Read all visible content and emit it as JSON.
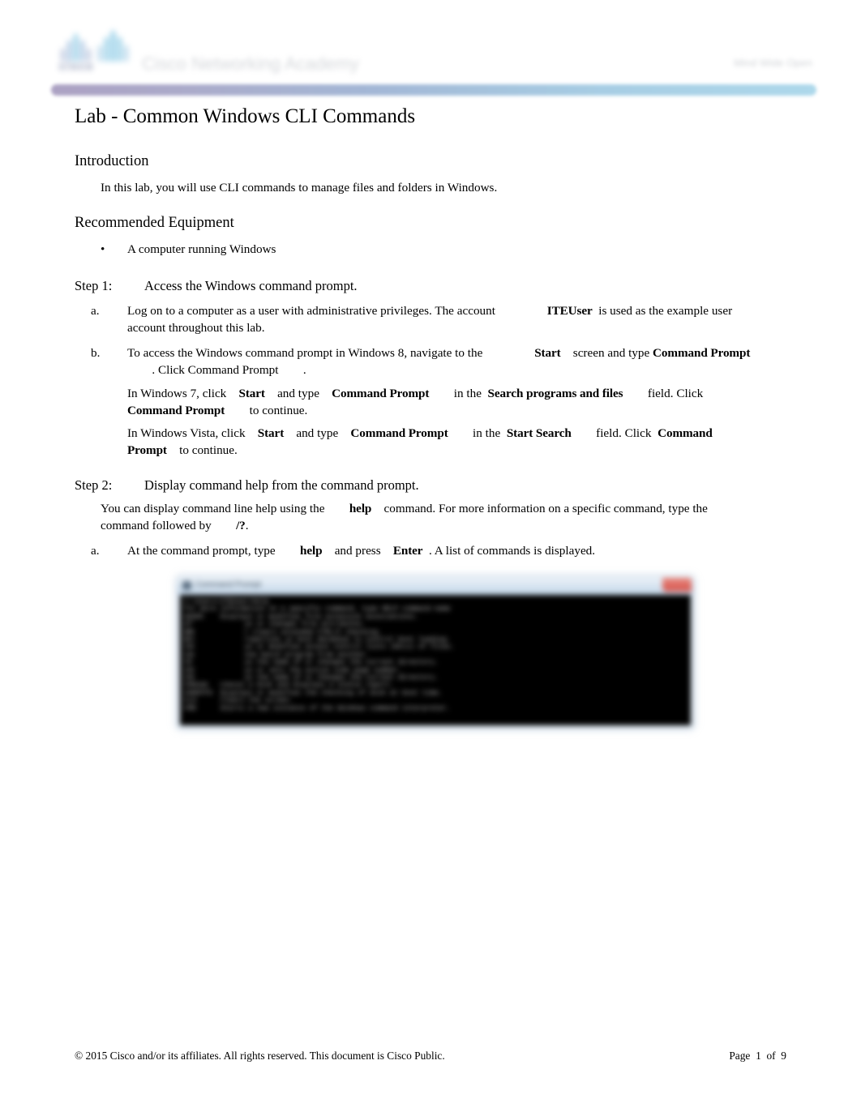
{
  "header": {
    "logo_word": "cisco",
    "brand": "Cisco Networking Academy",
    "tagline": "Mind Wide Open",
    "accent_left": "#a89dc0",
    "accent_right": "#a9d6ea"
  },
  "document": {
    "title": "Lab - Common Windows CLI Commands"
  },
  "sections": {
    "introduction": {
      "heading": "Introduction",
      "paragraph": "In this lab, you will use CLI commands to manage files and folders in Windows."
    },
    "equipment": {
      "heading": "Recommended Equipment",
      "bullet_glyph": "•",
      "items": [
        "A computer running Windows"
      ]
    }
  },
  "steps": [
    {
      "label": "Step 1:",
      "title": "Access the Windows command prompt.",
      "items": [
        {
          "marker": "a.",
          "text_1": "Log on to a computer as a user with administrative privileges. The account",
          "ui_1": "ITEUser",
          "text_2": "is used as the example user account throughout this lab."
        },
        {
          "marker": "b.",
          "text_1": "To access the Windows command prompt in Windows 8, navigate to the",
          "ui_1": "Start",
          "text_2": "screen and type",
          "ui_2": "Command Prompt",
          "text_3": ". Click Command Prompt",
          "text_4": "."
        }
      ],
      "paragraphs": [
        {
          "text_1": "In Windows 7, click",
          "ui_1": "Start",
          "text_2": "and type",
          "ui_2": "Command Prompt",
          "text_3": "in the",
          "ui_3": "Search programs and files",
          "text_4": "field. Click",
          "ui_4": "Command Prompt",
          "text_5": "to continue."
        },
        {
          "text_1": "In Windows Vista, click",
          "ui_1": "Start",
          "text_2": "and type",
          "ui_2": "Command Prompt",
          "text_3": "in the",
          "ui_3": "Start Search",
          "text_4": "field. Click",
          "ui_4": "Command Prompt",
          "text_5": "to continue."
        }
      ]
    },
    {
      "label": "Step 2:",
      "title": "Display command help from the command prompt.",
      "lead": {
        "text_1": "You can display command line help using the",
        "ui_1": "help",
        "text_2": "command. For more information on a specific command, type the command followed by",
        "ui_2": "/?",
        "text_3": "."
      },
      "items": [
        {
          "marker": "a.",
          "text_1": "At the command prompt, type",
          "ui_1": "help",
          "text_2": "and press",
          "ui_2": "Enter",
          "text_3": ". A list of commands is displayed."
        }
      ]
    }
  ],
  "screenshot": {
    "name": "command-prompt-help-output",
    "window_title": "Command Prompt",
    "close_label": "×",
    "terminal_text": "C:\\Users\\ITEUser>help\nFor more information on a specific command, type HELP command-name\nASSOC    Displays or modifies file extension associations.\nATTRIB   Displays or changes file attributes.\nBREAK    Sets or clears extended CTRL+C checking.\nBCDEDIT  Sets properties in boot database to control boot loading.\nCACLS    Displays or modifies access control lists (ACLs) of files.\nCALL     Calls one batch program from another.\nCD       Displays the name of or changes the current directory.\nCHCP     Displays or sets the active code page number.\nCHDIR    Displays the name of or changes the current directory.\nCHKDSK   Checks a disk and displays a status report.\nCHKNTFS  Displays or modifies the checking of disk at boot time.\nCLS      Clears the screen.\nCMD      Starts a new instance of the Windows command interpreter."
  },
  "footer": {
    "copyright": "© 2015 Cisco and/or its affiliates. All rights reserved. This document is Cisco Public.",
    "page_label": "Page",
    "page_number": "1",
    "page_of": "of",
    "page_total": "9"
  }
}
